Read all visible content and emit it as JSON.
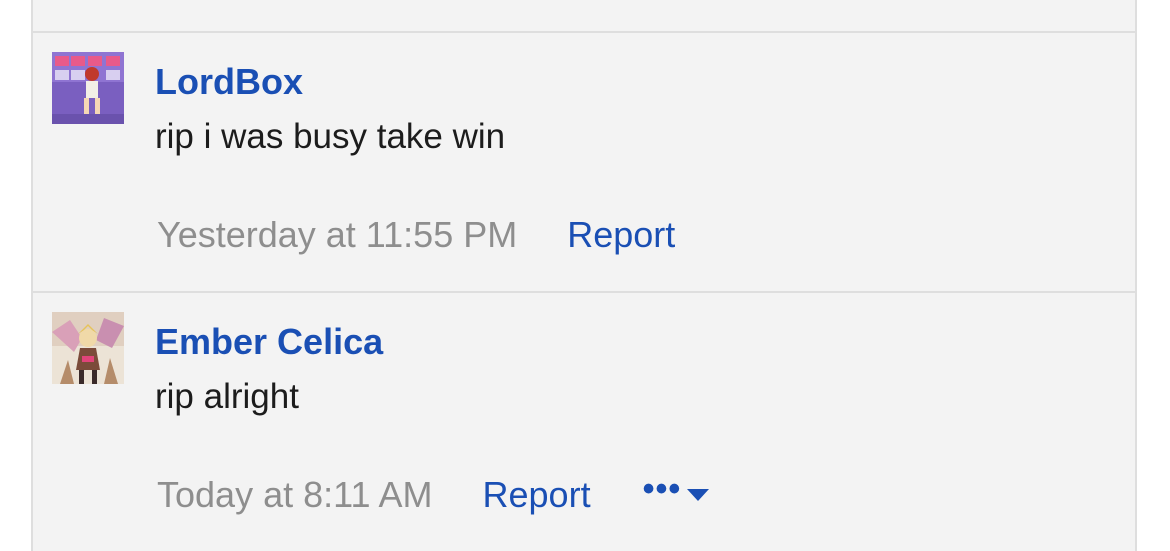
{
  "comments": [
    {
      "author": "LordBox",
      "text": "rip i was busy take win",
      "timestamp": "Yesterday at 11:55 PM",
      "report_label": "Report",
      "avatar_icon": "user-avatar-image"
    },
    {
      "author": "Ember Celica",
      "text": "rip alright",
      "timestamp": "Today at 8:11 AM",
      "report_label": "Report",
      "more_label": "•••",
      "more_icon": "caret-down-icon",
      "avatar_icon": "user-avatar-image"
    }
  ],
  "colors": {
    "link": "#1a4fb4",
    "muted": "#8e8e8e",
    "text": "#1c1c1c",
    "background": "#f3f3f3",
    "border": "#dedede"
  }
}
